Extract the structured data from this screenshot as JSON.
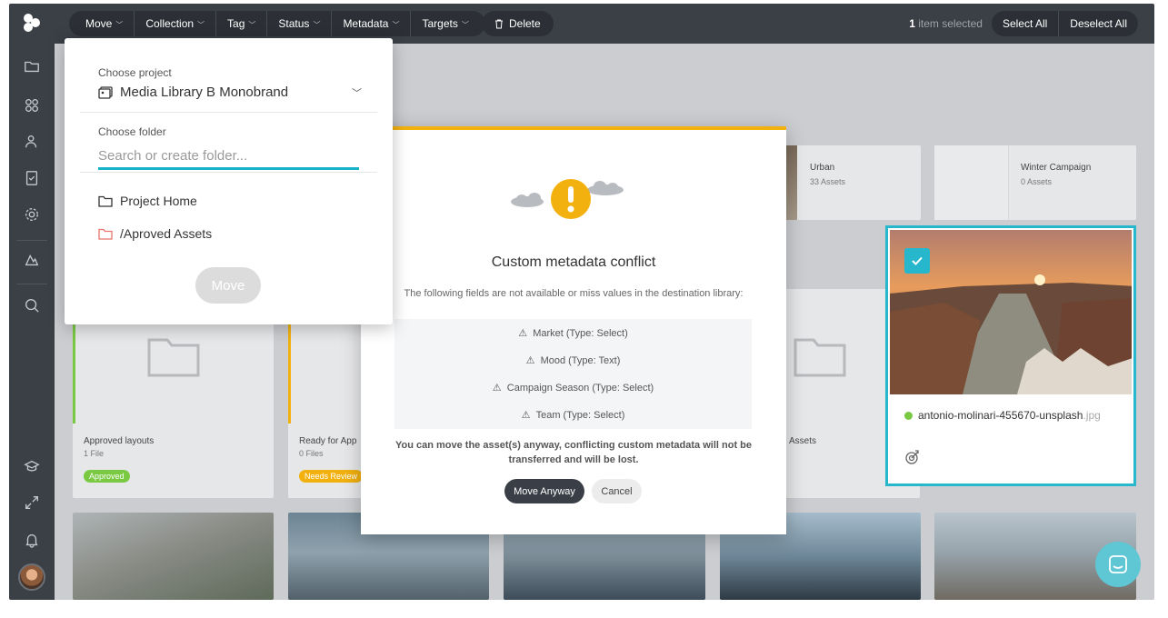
{
  "toolbar": {
    "menus": [
      {
        "label": "Move"
      },
      {
        "label": "Collection"
      },
      {
        "label": "Tag"
      },
      {
        "label": "Status"
      },
      {
        "label": "Metadata"
      },
      {
        "label": "Targets"
      }
    ],
    "delete_label": "Delete",
    "selected_count": "1",
    "selected_suffix": " item selected",
    "select_all": "Select All",
    "deselect_all": "Deselect All"
  },
  "move_panel": {
    "project_label": "Choose project",
    "project_value": "Media Library B Monobrand",
    "folder_label": "Choose folder",
    "folder_placeholder": "Search or create folder...",
    "folders": [
      {
        "label": "Project Home",
        "color": "#333333"
      },
      {
        "label": "/Aproved Assets",
        "color": "#e8736b"
      }
    ],
    "move_button": "Move"
  },
  "modal": {
    "title": "Custom metadata conflict",
    "description": "The following fields are not available or miss values in the destination library:",
    "fields": [
      "Market (Type: Select)",
      "Mood (Type: Text)",
      "Campaign Season (Type: Select)",
      "Team (Type: Select)"
    ],
    "warning": "You can move the asset(s) anyway, conflicting custom metadata will not be transferred and will be lost.",
    "move_anyway": "Move Anyway",
    "cancel": "Cancel",
    "accent": "#f2b10f"
  },
  "grid": {
    "collections": [
      {
        "title": "Urban",
        "subtitle": "33 Assets"
      },
      {
        "title": "Winter Campaign",
        "subtitle": "0 Assets"
      }
    ],
    "folders": [
      {
        "title": "Approved layouts",
        "subtitle": "1 File",
        "badge": "Approved",
        "badge_color": "#7ac943"
      },
      {
        "title": "Ready for App",
        "subtitle": "0 Files",
        "badge": "Needs Review",
        "badge_color": "#f2b10f"
      },
      {
        "title": "Assets",
        "subtitle": ""
      }
    ]
  },
  "selected_asset": {
    "name": "antonio-molinari-455670-unsplash",
    "extension": ".jpg",
    "status_color": "#7ac943"
  },
  "colors": {
    "sidebar": "#3b3f46",
    "selection": "#27b7cc"
  }
}
